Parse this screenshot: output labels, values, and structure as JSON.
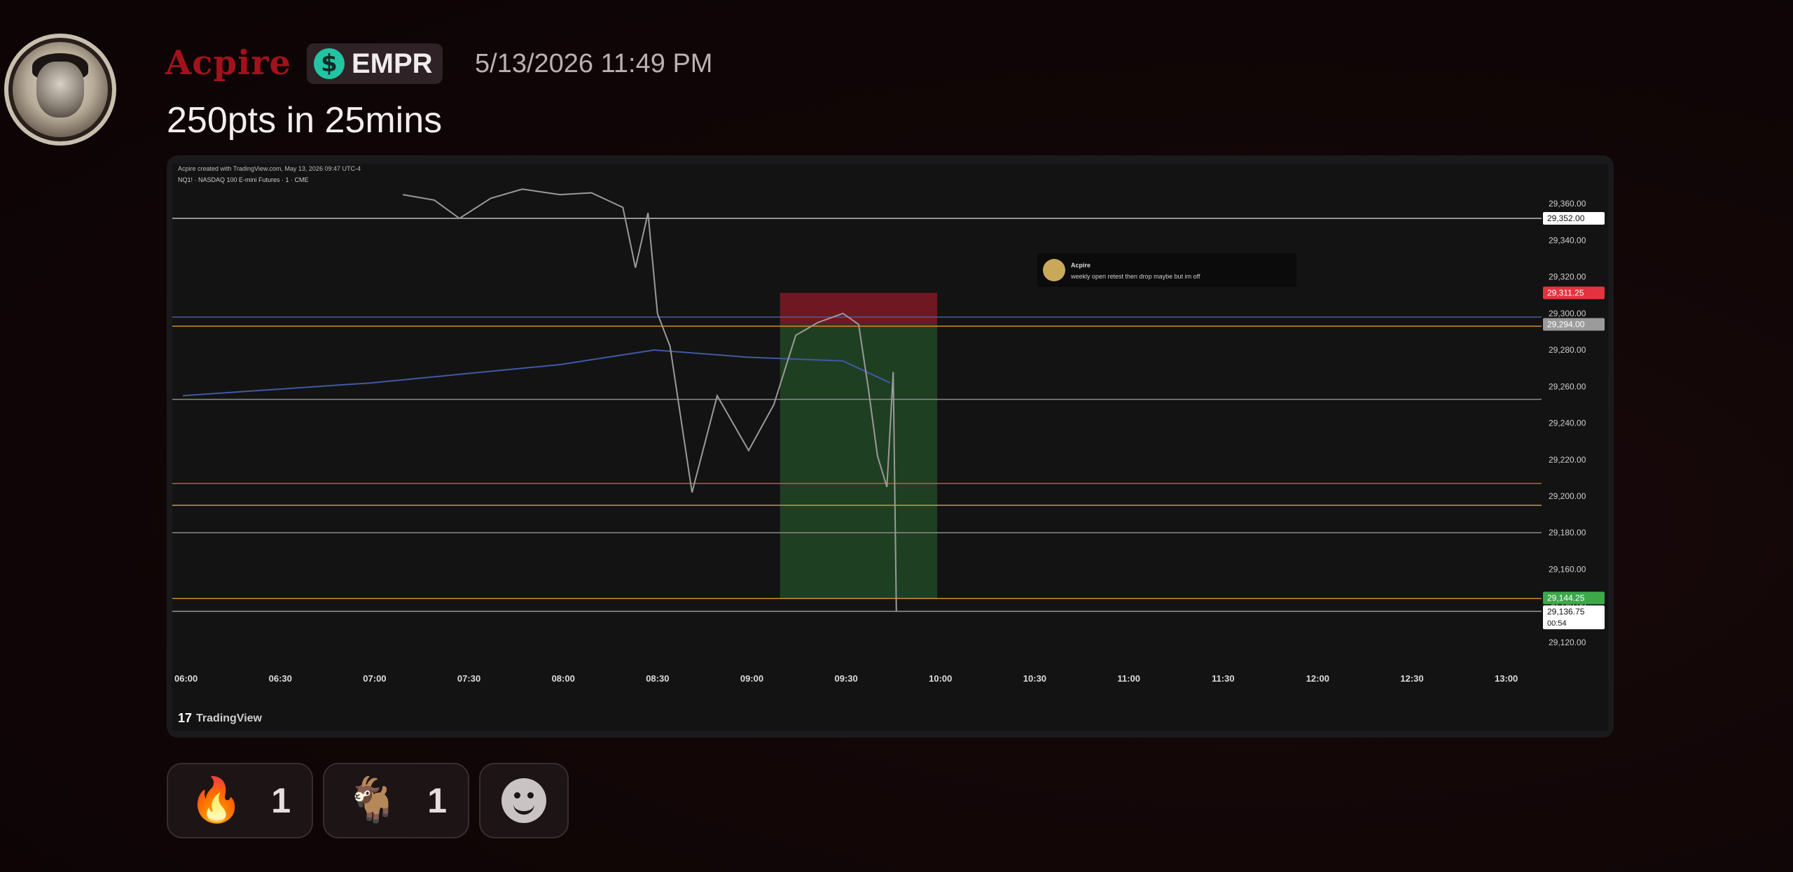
{
  "message": {
    "username": "Acpire",
    "role_tag": {
      "icon": "$",
      "label": "EMPR",
      "color": "#22c4a2"
    },
    "timestamp": "5/13/2026 11:49 PM",
    "text": "250pts in 25mins",
    "username_color": "#a3121c"
  },
  "chart_data": {
    "type": "line",
    "header_text": "Acpire created with TradingView.com, May 13, 2026 09:47 UTC-4",
    "symbol_text": "NQ1! · NASDAQ 100 E-mini Futures · 1 · CME",
    "footer_brand": "TradingView",
    "x_ticks": [
      "06:00",
      "06:30",
      "07:00",
      "07:30",
      "08:00",
      "08:30",
      "09:00",
      "09:30",
      "10:00",
      "10:30",
      "11:00",
      "11:30",
      "12:00",
      "12:30",
      "13:00"
    ],
    "y_ticks": [
      "29,360.00",
      "29,340.00",
      "29,320.00",
      "29,300.00",
      "29,280.00",
      "29,260.00",
      "29,240.00",
      "29,220.00",
      "29,200.00",
      "29,180.00",
      "29,160.00",
      "29,140.00",
      "29,120.00"
    ],
    "ylim": [
      29110,
      29375
    ],
    "price_labels": [
      {
        "text": "29,352.00",
        "value": 29352,
        "color": "#ffffff",
        "text_color": "#111111"
      },
      {
        "text": "29,311.25",
        "value": 29311.25,
        "color": "#e5323f",
        "text_color": "#ffffff"
      },
      {
        "text": "29,294.00",
        "value": 29294,
        "color": "#9b9b9b",
        "text_color": "#ffffff"
      },
      {
        "text": "29,144.25",
        "value": 29144.25,
        "color": "#3ca84a",
        "text_color": "#ffffff"
      },
      {
        "text": "29,136.75",
        "value": 29136.75,
        "color": "#ffffff",
        "text_color": "#111111",
        "sub": "00:54"
      }
    ],
    "horizontal_levels": [
      {
        "value": 29352,
        "color": "#bfbfbf"
      },
      {
        "value": 29298,
        "color": "#4a5f9a"
      },
      {
        "value": 29293,
        "color": "#d28a2a"
      },
      {
        "value": 29253,
        "color": "#8a8a8a"
      },
      {
        "value": 29207,
        "color": "#d0542a"
      },
      {
        "value": 29195,
        "color": "#b7a23a"
      },
      {
        "value": 29180,
        "color": "#8a8a8a"
      },
      {
        "value": 29144,
        "color": "#d28a2a"
      },
      {
        "value": 29137,
        "color": "#9a9a9a"
      }
    ],
    "vwap_series": [
      {
        "x": "06:00",
        "y": 29255
      },
      {
        "x": "07:00",
        "y": 29262
      },
      {
        "x": "08:00",
        "y": 29272
      },
      {
        "x": "08:30",
        "y": 29280
      },
      {
        "x": "09:00",
        "y": 29276
      },
      {
        "x": "09:30",
        "y": 29274
      },
      {
        "x": "09:45",
        "y": 29262
      }
    ],
    "price_series": [
      {
        "x": "07:10",
        "y": 29365
      },
      {
        "x": "07:20",
        "y": 29362
      },
      {
        "x": "07:28",
        "y": 29352
      },
      {
        "x": "07:38",
        "y": 29363
      },
      {
        "x": "07:48",
        "y": 29368
      },
      {
        "x": "08:00",
        "y": 29365
      },
      {
        "x": "08:10",
        "y": 29366
      },
      {
        "x": "08:20",
        "y": 29358
      },
      {
        "x": "08:24",
        "y": 29325
      },
      {
        "x": "08:28",
        "y": 29355
      },
      {
        "x": "08:31",
        "y": 29300
      },
      {
        "x": "08:35",
        "y": 29282
      },
      {
        "x": "08:42",
        "y": 29202
      },
      {
        "x": "08:50",
        "y": 29255
      },
      {
        "x": "09:00",
        "y": 29225
      },
      {
        "x": "09:08",
        "y": 29250
      },
      {
        "x": "09:15",
        "y": 29288
      },
      {
        "x": "09:22",
        "y": 29295
      },
      {
        "x": "09:30",
        "y": 29300
      },
      {
        "x": "09:35",
        "y": 29294
      },
      {
        "x": "09:38",
        "y": 29260
      },
      {
        "x": "09:41",
        "y": 29222
      },
      {
        "x": "09:44",
        "y": 29205
      },
      {
        "x": "09:46",
        "y": 29268
      },
      {
        "x": "09:47",
        "y": 29137
      }
    ],
    "position": {
      "entry": 29294,
      "stop": 29311.25,
      "target": 29144.25,
      "start": "09:10",
      "end": "10:00"
    },
    "note": {
      "author": "Acpire",
      "text": "weekly open retest then drop maybe but im off"
    }
  },
  "reactions": [
    {
      "emoji": "🔥",
      "count": "1"
    },
    {
      "emoji": "🐐",
      "count": "1"
    }
  ],
  "icons": {
    "add_reaction": "smiley-icon",
    "role": "dollar-icon"
  }
}
